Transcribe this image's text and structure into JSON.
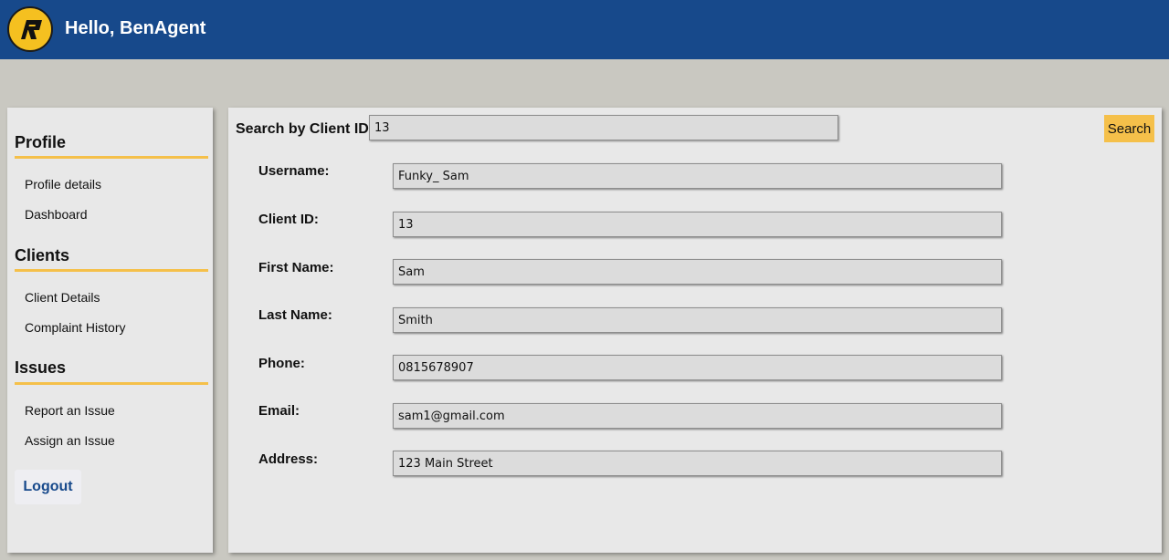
{
  "header": {
    "logo_icon": "company-logo",
    "greeting": "Hello, BenAgent",
    "background_color": "#17498b"
  },
  "sidebar": {
    "sections": [
      {
        "title": "Profile",
        "items": [
          "Profile details",
          "Dashboard"
        ]
      },
      {
        "title": "Clients",
        "items": [
          "Client Details",
          "Complaint History"
        ]
      },
      {
        "title": "Issues",
        "items": [
          "Report an Issue",
          "Assign an Issue"
        ]
      }
    ],
    "logout_label": "Logout",
    "accent_color": "#f5c04a"
  },
  "search": {
    "label": "Search by Client ID:",
    "value": "13",
    "button_label": "Search"
  },
  "client_form": {
    "fields": [
      {
        "label": "Username:",
        "value": "Funky_ Sam"
      },
      {
        "label": "Client ID:",
        "value": "13"
      },
      {
        "label": "First Name:",
        "value": "Sam"
      },
      {
        "label": "Last Name:",
        "value": "Smith"
      },
      {
        "label": "Phone:",
        "value": "0815678907"
      },
      {
        "label": "Email:",
        "value": "sam1@gmail.com"
      },
      {
        "label": "Address:",
        "value": "123 Main Street"
      }
    ]
  }
}
